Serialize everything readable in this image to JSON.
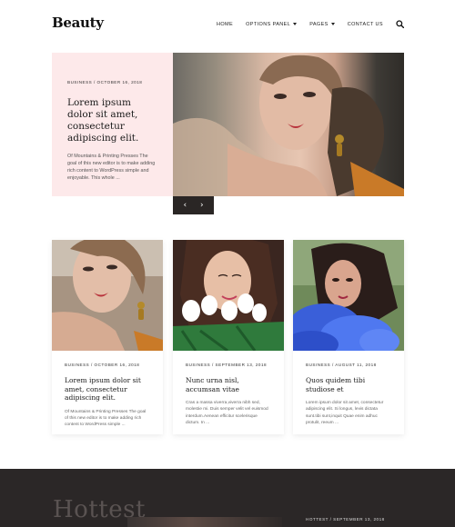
{
  "header": {
    "logo": "Beauty",
    "nav": [
      {
        "label": "HOME",
        "has_dropdown": false
      },
      {
        "label": "OPTIONS PANEL",
        "has_dropdown": true
      },
      {
        "label": "PAGES",
        "has_dropdown": true
      },
      {
        "label": "CONTACT US",
        "has_dropdown": false
      }
    ],
    "search_icon": "search-icon"
  },
  "hero": {
    "meta": "BUSINESS / OCTOBER 16, 2018",
    "title": "Lorem ipsum dolor sit amet, consectetur adipiscing elit.",
    "excerpt": "Of Mountains & Printing Presses The goal of this new editor is to make adding rich content to WordPress simple and enjoyable. This whole ...",
    "prev_icon": "chevron-left-icon",
    "next_icon": "chevron-right-icon"
  },
  "cards": [
    {
      "meta": "BUSINESS / OCTOBER 16, 2018",
      "title": "Lorem ipsum dolor sit amet, consectetur adipiscing elit.",
      "excerpt": "Of Mountains & Printing Presses The goal of this new editor is to make adding rich content to WordPress simple ..."
    },
    {
      "meta": "BUSINESS / SEPTEMBER 13, 2018",
      "title": "Nunc urna nisl, accumsan vitae",
      "excerpt": "Cras a massa viverra,viverra nibh sed, molestie mi. Duis semper velit vel euismod interdum.Aenean efficitur scelerisque dictum. In ..."
    },
    {
      "meta": "BUSINESS / AUGUST 11, 2018",
      "title": "Quos quidem tibi studiose et",
      "excerpt": "Lorem ipsum dolor sit amet, consectetur adipiscing elit. Si longus, levis dictata sunt.tibi sunt,inquit Quae enim adhuc protulit, reeum ..."
    }
  ],
  "band": {
    "heading": "Hottest",
    "meta": "HOTTEST / SEPTEMBER 13, 2018"
  },
  "colors": {
    "hero_card_bg": "#fde9ea",
    "band_bg": "#2b2727",
    "slider_bg": "#2a2625"
  }
}
